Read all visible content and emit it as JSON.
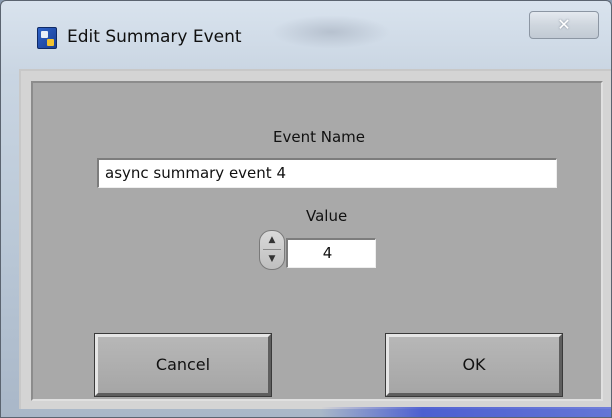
{
  "window": {
    "title": "Edit Summary Event",
    "close_label": "✕"
  },
  "form": {
    "event_name_label": "Event Name",
    "event_name_value": "async summary event 4",
    "value_label": "Value",
    "value": "4",
    "stepper_up_glyph": "▲",
    "stepper_down_glyph": "▼"
  },
  "buttons": {
    "cancel_label": "Cancel",
    "ok_label": "OK"
  },
  "colors": {
    "client_background": "#a9a9a9",
    "frame": "#c9d5e2",
    "title_icon": "#2e62c8"
  }
}
